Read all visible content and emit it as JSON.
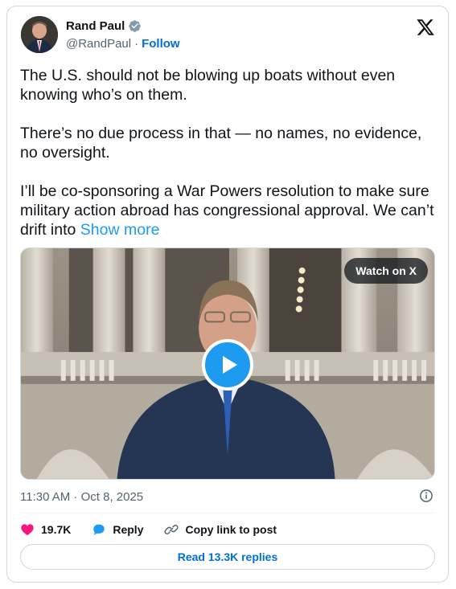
{
  "author": {
    "name": "Rand Paul",
    "handle": "@RandPaul",
    "separator": "·",
    "follow_label": "Follow"
  },
  "tweet": {
    "paragraph_1": "The U.S. should not be blowing up boats without even knowing who’s on them.",
    "paragraph_2": "There’s no due process in that — no names, no evidence, no oversight.",
    "paragraph_3": "I’ll be co-sponsoring a War Powers resolution to make sure military action abroad has congressional approval. We can’t drift into",
    "show_more": "Show more"
  },
  "media": {
    "watch_label": "Watch on X"
  },
  "timestamp": "11:30 AM · Oct 8, 2025",
  "actions": {
    "likes": "19.7K",
    "reply_label": "Reply",
    "copy_link_label": "Copy link to post"
  },
  "read_replies_label": "Read 13.3K replies",
  "colors": {
    "accent": "#1d9bf0",
    "link": "#006fd6",
    "like": "#f91880",
    "muted": "#536471"
  },
  "icons": [
    "verified-badge-icon",
    "x-logo-icon",
    "play-icon",
    "info-icon",
    "heart-icon",
    "reply-bubble-icon",
    "link-icon"
  ]
}
